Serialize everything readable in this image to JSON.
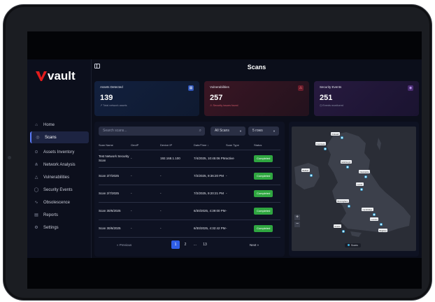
{
  "brand": {
    "name": "vault",
    "logo_color": "#e21c1c"
  },
  "page": {
    "title": "Scans"
  },
  "sidebar": {
    "items": [
      {
        "label": "Home",
        "icon": "home-icon",
        "glyph": "⌂",
        "active": false
      },
      {
        "label": "Scans",
        "icon": "scan-icon",
        "glyph": "◎",
        "active": true
      },
      {
        "label": "Assets Inventory",
        "icon": "assets-icon",
        "glyph": "⊙",
        "active": false
      },
      {
        "label": "Network Analysis",
        "icon": "network-icon",
        "glyph": "⋔",
        "active": false
      },
      {
        "label": "Vulnerabilities",
        "icon": "warning-icon",
        "glyph": "△",
        "active": false
      },
      {
        "label": "Security Events",
        "icon": "security-event-icon",
        "glyph": "◯",
        "active": false
      },
      {
        "label": "Obsolescence",
        "icon": "pulse-icon",
        "glyph": "∿",
        "active": false
      },
      {
        "label": "Reports",
        "icon": "reports-icon",
        "glyph": "▤",
        "active": false
      },
      {
        "label": "Settings",
        "icon": "gear-icon",
        "glyph": "⚙",
        "active": false
      }
    ]
  },
  "cards": [
    {
      "title": "Assets Detected",
      "value": "139",
      "sub": "↗ Total network assets",
      "icon": "server-icon",
      "glyph": "▤",
      "sub_color": "#8c92a8"
    },
    {
      "title": "Vulnerabilities",
      "value": "257",
      "sub": "⚠ Security issues found",
      "icon": "warning-icon",
      "glyph": "⚠",
      "sub_color": "#d05a6a"
    },
    {
      "title": "Security Events",
      "value": "251",
      "sub": "◷ Events monitored",
      "icon": "shield-icon",
      "glyph": "◉",
      "sub_color": "#8c92a8"
    }
  ],
  "search": {
    "placeholder": "Search scans..."
  },
  "filters": {
    "scan_filter": "All Scans",
    "rows_filter": "5 rows"
  },
  "table": {
    "headers": [
      "Scan Name",
      "GeoIP",
      "Device IP",
      "Date/Time ↓",
      "Scan Type",
      "Status"
    ],
    "rows": [
      {
        "name": "Test Network Security Scan",
        "geoip": "-",
        "ip": "192.168.1.100",
        "datetime": "7/4/2025, 10:45:06 PM",
        "type": "active",
        "status": "Completed"
      },
      {
        "name": "Scan 2/7/2025",
        "geoip": "-",
        "ip": "-",
        "datetime": "7/2/2025, 9:36:20 PM",
        "type": "-",
        "status": "Completed"
      },
      {
        "name": "Scan 2/7/2025",
        "geoip": "-",
        "ip": "-",
        "datetime": "7/2/2025, 9:20:21 PM",
        "type": "-",
        "status": "Completed"
      },
      {
        "name": "Scan 30/6/2025",
        "geoip": "-",
        "ip": "-",
        "datetime": "6/30/2025, 4:39:00 PM",
        "type": "-",
        "status": "Completed"
      },
      {
        "name": "Scan 30/6/2025",
        "geoip": "-",
        "ip": "-",
        "datetime": "6/30/2025, 4:32:42 PM",
        "type": "-",
        "status": "Completed"
      }
    ]
  },
  "pagination": {
    "prev": "« Previous",
    "pages": [
      "1",
      "2",
      "...",
      "13"
    ],
    "current": "1",
    "next": "Next »"
  },
  "map": {
    "zoom_in": "+",
    "zoom_out": "−",
    "legend": "Scans"
  }
}
